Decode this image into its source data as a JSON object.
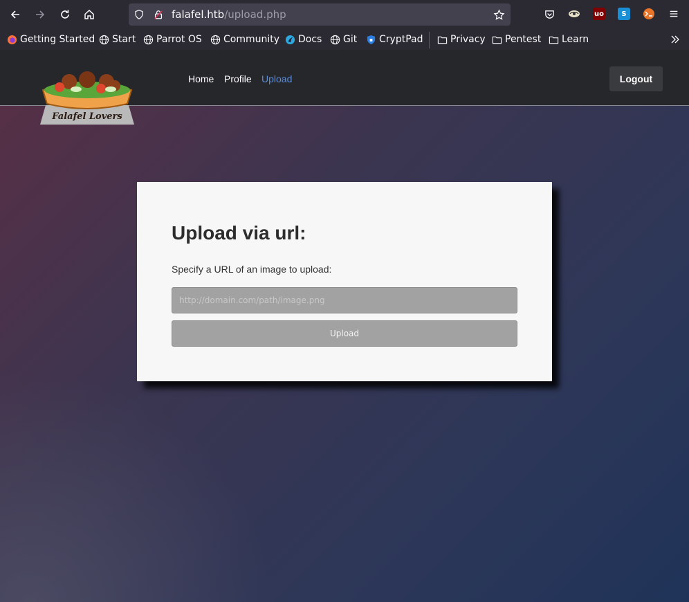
{
  "browser": {
    "url_host": "falafel.htb",
    "url_path": "/upload.php",
    "bookmarks": [
      {
        "label": "Getting Started",
        "icon": "firefox-icon"
      },
      {
        "label": "Start",
        "icon": "globe-icon"
      },
      {
        "label": "Parrot OS",
        "icon": "globe-icon"
      },
      {
        "label": "Community",
        "icon": "globe-icon"
      },
      {
        "label": "Docs",
        "icon": "docs-icon"
      },
      {
        "label": "Git",
        "icon": "globe-icon"
      },
      {
        "label": "CryptPad",
        "icon": "shield-icon"
      },
      {
        "label": "Privacy",
        "icon": "folder-icon"
      },
      {
        "label": "Pentest",
        "icon": "folder-icon"
      },
      {
        "label": "Learn",
        "icon": "folder-icon"
      }
    ],
    "extensions": [
      {
        "name": "pocket-icon"
      },
      {
        "name": "hackbar-icon"
      },
      {
        "name": "ublock-icon",
        "text": "uo"
      },
      {
        "name": "s-extension-icon",
        "text": "S"
      },
      {
        "name": "foxyproxy-icon"
      }
    ]
  },
  "site": {
    "logo_text": "Falafel Lovers",
    "nav": [
      {
        "label": "Home"
      },
      {
        "label": "Profile"
      },
      {
        "label": "Upload"
      }
    ],
    "logout_label": "Logout"
  },
  "upload": {
    "title": "Upload via url:",
    "description": "Specify a URL of an image to upload:",
    "url_placeholder": "http://domain.com/path/image.png",
    "url_value": "",
    "button_label": "Upload"
  },
  "colors": {
    "accent_link": "#5b8dd9",
    "navbar_bg": "#26272b",
    "card_bg": "#f7f7f7",
    "input_bg": "#a2a2a2"
  }
}
